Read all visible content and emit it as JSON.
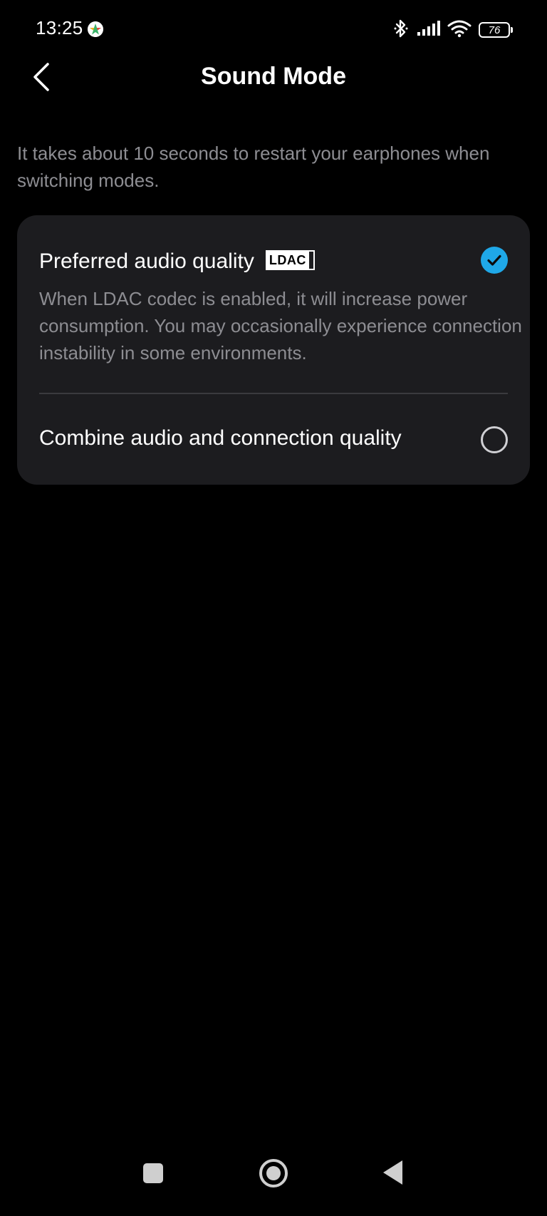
{
  "status_bar": {
    "time": "13:25",
    "battery_level": "76",
    "icons": [
      "bluetooth-icon",
      "signal-icon",
      "wifi-icon",
      "battery-icon"
    ]
  },
  "header": {
    "title": "Sound Mode",
    "back_icon": "chevron-left-icon"
  },
  "hint": "It takes about 10 seconds to restart your earphones when switching modes.",
  "options": [
    {
      "title": "Preferred audio quality",
      "badge": "LDAC",
      "description": "When LDAC codec is enabled, it will increase power consumption. You may occasionally experience connection instability in some environments.",
      "selected": true
    },
    {
      "title": "Combine audio and connection quality",
      "selected": false
    }
  ],
  "colors": {
    "background": "#000000",
    "card": "#1c1c1f",
    "accent": "#1fa8e8",
    "secondary_text": "#8d8d92"
  },
  "nav_bar": {
    "icons": [
      "recents-icon",
      "home-icon",
      "back-triangle-icon"
    ]
  }
}
